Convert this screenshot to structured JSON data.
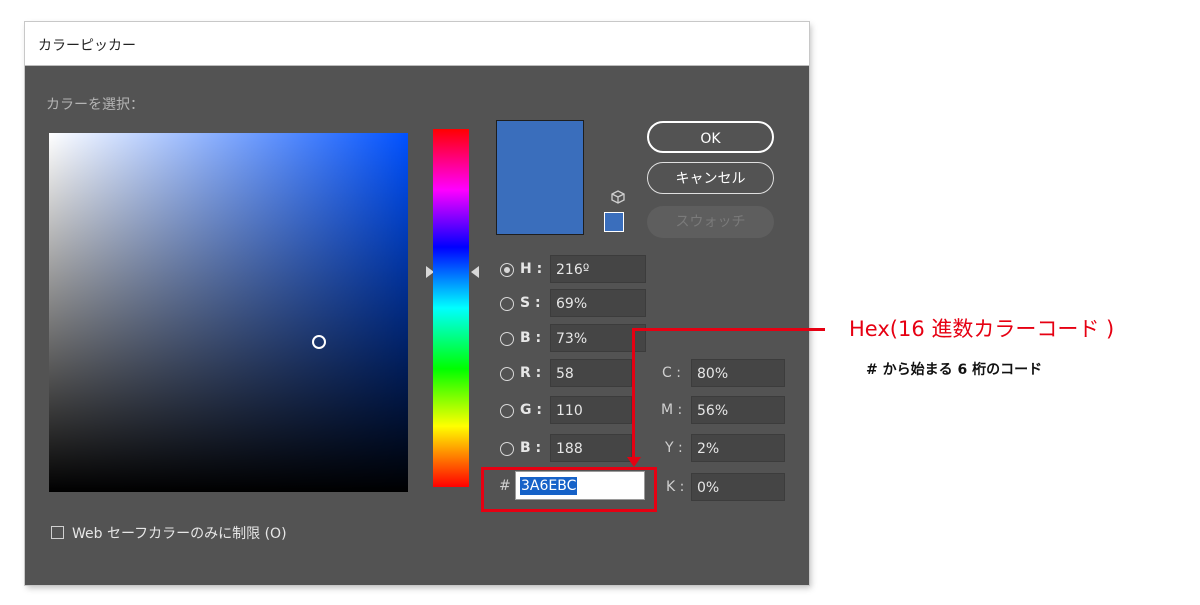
{
  "dialog": {
    "title": "カラーピッカー",
    "select_label": "カラーを選択：",
    "buttons": {
      "ok": "OK",
      "cancel": "キャンセル",
      "swatches": "スウォッチ"
    },
    "fields": {
      "h": {
        "label": "H :",
        "value": "216º",
        "checked": true
      },
      "s": {
        "label": "S :",
        "value": "69%"
      },
      "b": {
        "label": "B :",
        "value": "73%"
      },
      "r": {
        "label": "R :",
        "value": "58"
      },
      "g": {
        "label": "G :",
        "value": "110"
      },
      "b2": {
        "label": "B :",
        "value": "188"
      }
    },
    "cmyk": {
      "c": {
        "label": "C :",
        "value": "80%"
      },
      "m": {
        "label": "M :",
        "value": "56%"
      },
      "y": {
        "label": "Y :",
        "value": "2%"
      },
      "k": {
        "label": "K :",
        "value": "0%"
      }
    },
    "hex": {
      "label": "#",
      "value": "3A6EBC"
    },
    "websafe_label": "Web セーフカラーのみに制限 (O)",
    "current_color": "#3a6ebc"
  },
  "annotation": {
    "title": "Hex(16 進数カラーコード )",
    "subtitle": "# から始まる 6 桁のコード",
    "color": "#e60012"
  }
}
